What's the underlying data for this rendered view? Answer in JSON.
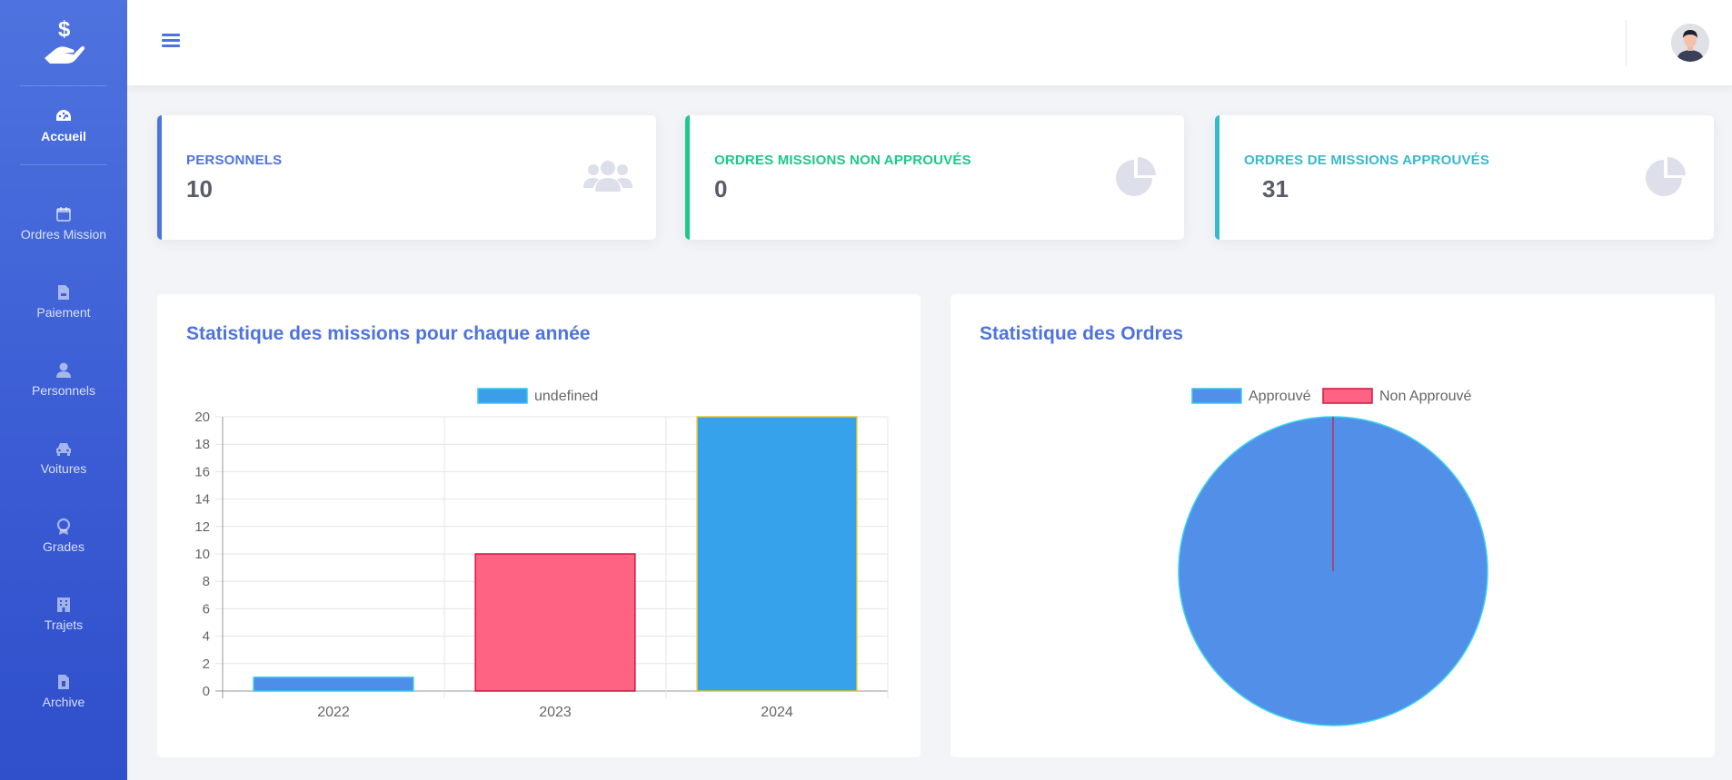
{
  "sidebar": {
    "brand_icon": "money-hand-icon",
    "items": [
      {
        "label": "Accueil",
        "icon": "dashboard-icon",
        "active": true
      },
      {
        "label": "Ordres Mission",
        "icon": "calendar-icon"
      },
      {
        "label": "Paiement",
        "icon": "file-invoice-icon"
      },
      {
        "label": "Personnels",
        "icon": "user-icon"
      },
      {
        "label": "Voitures",
        "icon": "car-icon"
      },
      {
        "label": "Grades",
        "icon": "award-icon"
      },
      {
        "label": "Trajets",
        "icon": "building-icon"
      },
      {
        "label": "Archive",
        "icon": "file-icon"
      }
    ]
  },
  "topbar": {
    "menu_icon": "hamburger-icon",
    "avatar_icon": "user-avatar-icon"
  },
  "stats": [
    {
      "label": "PERSONNELS",
      "value": "10",
      "color": "#4e73df",
      "icon": "users-icon"
    },
    {
      "label": "ORDRES MISSIONS NON APPROUVÉS",
      "value": "0",
      "color": "#1cc88a",
      "icon": "pie-chart-icon"
    },
    {
      "label": "ORDRES DE MISSIONS APPROUVÉS",
      "value": "31",
      "color": "#36b9cc",
      "icon": "pie-chart-icon"
    }
  ],
  "panels": {
    "bar_title": "Statistique des missions pour chaque année",
    "pie_title": "Statistique des Ordres"
  },
  "chart_data": [
    {
      "type": "bar",
      "title": "Statistique des missions pour chaque année",
      "categories": [
        "2022",
        "2023",
        "2024"
      ],
      "series": [
        {
          "name": "undefined",
          "values": [
            1,
            10,
            20
          ]
        }
      ],
      "bar_colors": [
        "#4e8de8",
        "#ff6384",
        "#36a2eb"
      ],
      "ylim": [
        0,
        20
      ],
      "yticks": [
        0,
        2,
        4,
        6,
        8,
        10,
        12,
        14,
        16,
        18,
        20
      ],
      "legend": "top",
      "grid": true
    },
    {
      "type": "pie",
      "title": "Statistique des Ordres",
      "labels": [
        "Approuvé",
        "Non Approuvé"
      ],
      "values": [
        31,
        0
      ],
      "colors": [
        "#528fe8",
        "#ff6384"
      ],
      "legend": "top"
    }
  ]
}
